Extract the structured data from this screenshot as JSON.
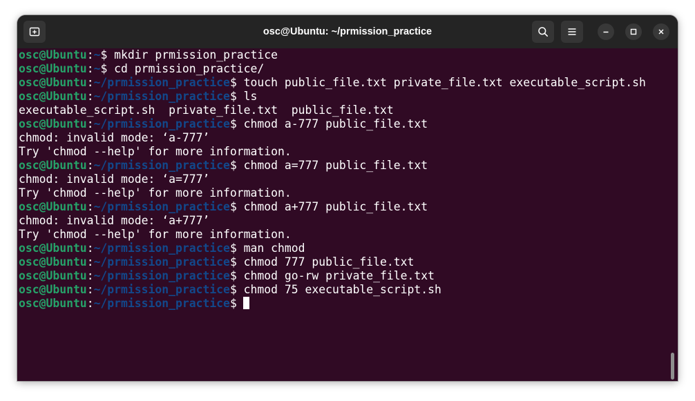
{
  "window": {
    "title": "osc@Ubuntu: ~/prmission_practice"
  },
  "colors": {
    "terminal_background": "#300a24",
    "user_host": "#26a269",
    "path": "#12488b",
    "text": "#ffffff",
    "titlebar": "#242424"
  },
  "titlebar": {
    "new_tab_icon": "new-tab-icon",
    "search_icon": "search-icon",
    "menu_icon": "hamburger-menu-icon",
    "minimize_icon": "minimize-icon",
    "maximize_icon": "maximize-icon",
    "close_icon": "close-icon"
  },
  "terminal": {
    "user_host": "osc@Ubuntu",
    "lines": [
      {
        "type": "prompt",
        "path": "~",
        "command": " mkdir prmission_practice"
      },
      {
        "type": "prompt",
        "path": "~",
        "command": " cd prmission_practice/"
      },
      {
        "type": "prompt",
        "path": "~/prmission_practice",
        "command": " touch public_file.txt private_file.txt executable_script.sh"
      },
      {
        "type": "prompt",
        "path": "~/prmission_practice",
        "command": " ls"
      },
      {
        "type": "output",
        "text": "executable_script.sh  private_file.txt  public_file.txt"
      },
      {
        "type": "prompt",
        "path": "~/prmission_practice",
        "command": " chmod a-777 public_file.txt"
      },
      {
        "type": "output",
        "text": "chmod: invalid mode: ‘a-777’"
      },
      {
        "type": "output",
        "text": "Try 'chmod --help' for more information."
      },
      {
        "type": "prompt",
        "path": "~/prmission_practice",
        "command": " chmod a=777 public_file.txt"
      },
      {
        "type": "output",
        "text": "chmod: invalid mode: ‘a=777’"
      },
      {
        "type": "output",
        "text": "Try 'chmod --help' for more information."
      },
      {
        "type": "prompt",
        "path": "~/prmission_practice",
        "command": " chmod a+777 public_file.txt"
      },
      {
        "type": "output",
        "text": "chmod: invalid mode: ‘a+777’"
      },
      {
        "type": "output",
        "text": "Try 'chmod --help' for more information."
      },
      {
        "type": "prompt",
        "path": "~/prmission_practice",
        "command": " man chmod"
      },
      {
        "type": "prompt",
        "path": "~/prmission_practice",
        "command": " chmod 777 public_file.txt"
      },
      {
        "type": "prompt",
        "path": "~/prmission_practice",
        "command": " chmod go-rw private_file.txt"
      },
      {
        "type": "prompt",
        "path": "~/prmission_practice",
        "command": " chmod 75 executable_script.sh"
      },
      {
        "type": "prompt",
        "path": "~/prmission_practice",
        "command": "",
        "cursor": true
      }
    ]
  }
}
